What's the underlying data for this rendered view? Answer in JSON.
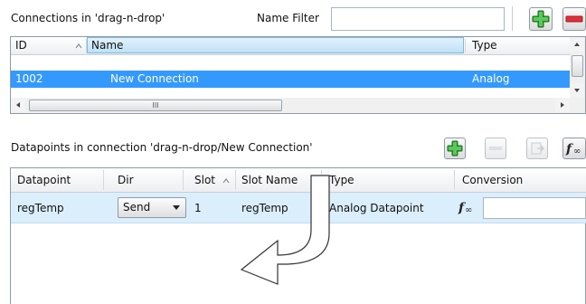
{
  "connections_panel": {
    "title": "Connections in 'drag-n-drop'",
    "name_filter_label": "Name Filter",
    "name_filter_value": "",
    "columns": [
      "ID",
      "Name",
      "Type"
    ],
    "rows": [
      {
        "id": "1002",
        "name": "New Connection",
        "type": "Analog"
      }
    ],
    "hscroll_thumb_glyph": "III"
  },
  "datapoints_panel": {
    "title": "Datapoints in connection 'drag-n-drop/New Connection'",
    "columns": [
      "Datapoint",
      "Dir",
      "Slot",
      "Slot Name",
      "Type",
      "Conversion"
    ],
    "rows": [
      {
        "datapoint": "regTemp",
        "dir": "Send",
        "slot": "1",
        "slot_name": "regTemp",
        "type": "Analog Datapoint",
        "conversion": ""
      }
    ]
  },
  "icons": {
    "add": "plus-icon",
    "remove": "minus-icon",
    "export": "export-icon",
    "function": "function-icon",
    "sort": "sort-ascending-icon",
    "drag_hint": "curved-arrow-icon"
  },
  "colors": {
    "selection": "#3399ff",
    "header_selected": "#c4e3f7",
    "add_green": "#2f9f2f",
    "remove_red": "#e0303a"
  }
}
